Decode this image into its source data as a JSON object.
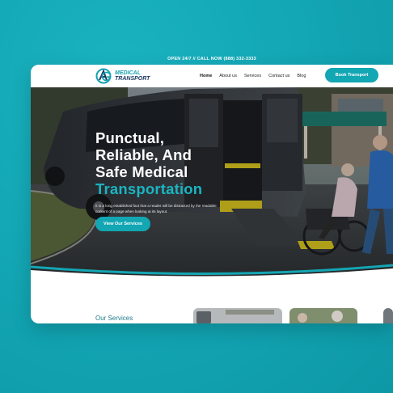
{
  "topbar": {
    "text": "OPEN 24/7 // CALL NOW (888) 332-3333"
  },
  "logo": {
    "line1": "MEDICAL",
    "line2": "TRANSPORT"
  },
  "nav": {
    "items": [
      {
        "label": "Home"
      },
      {
        "label": "About us"
      },
      {
        "label": "Services"
      },
      {
        "label": "Contact us"
      },
      {
        "label": "Blog"
      }
    ],
    "cta": "Book Transport"
  },
  "hero": {
    "line1": "Punctual,",
    "line2": "Reliable, And",
    "line3": "Safe Medical",
    "line4": "Transportation",
    "desc": "It is a long established fact that a reader will be distracted by the readable content of a page when looking at its layout.",
    "cta": "View Our Services"
  },
  "services": {
    "heading": "Our Services"
  },
  "colors": {
    "accent": "#13a6b3",
    "navy": "#1d3a63",
    "background": "#12a7b5"
  }
}
